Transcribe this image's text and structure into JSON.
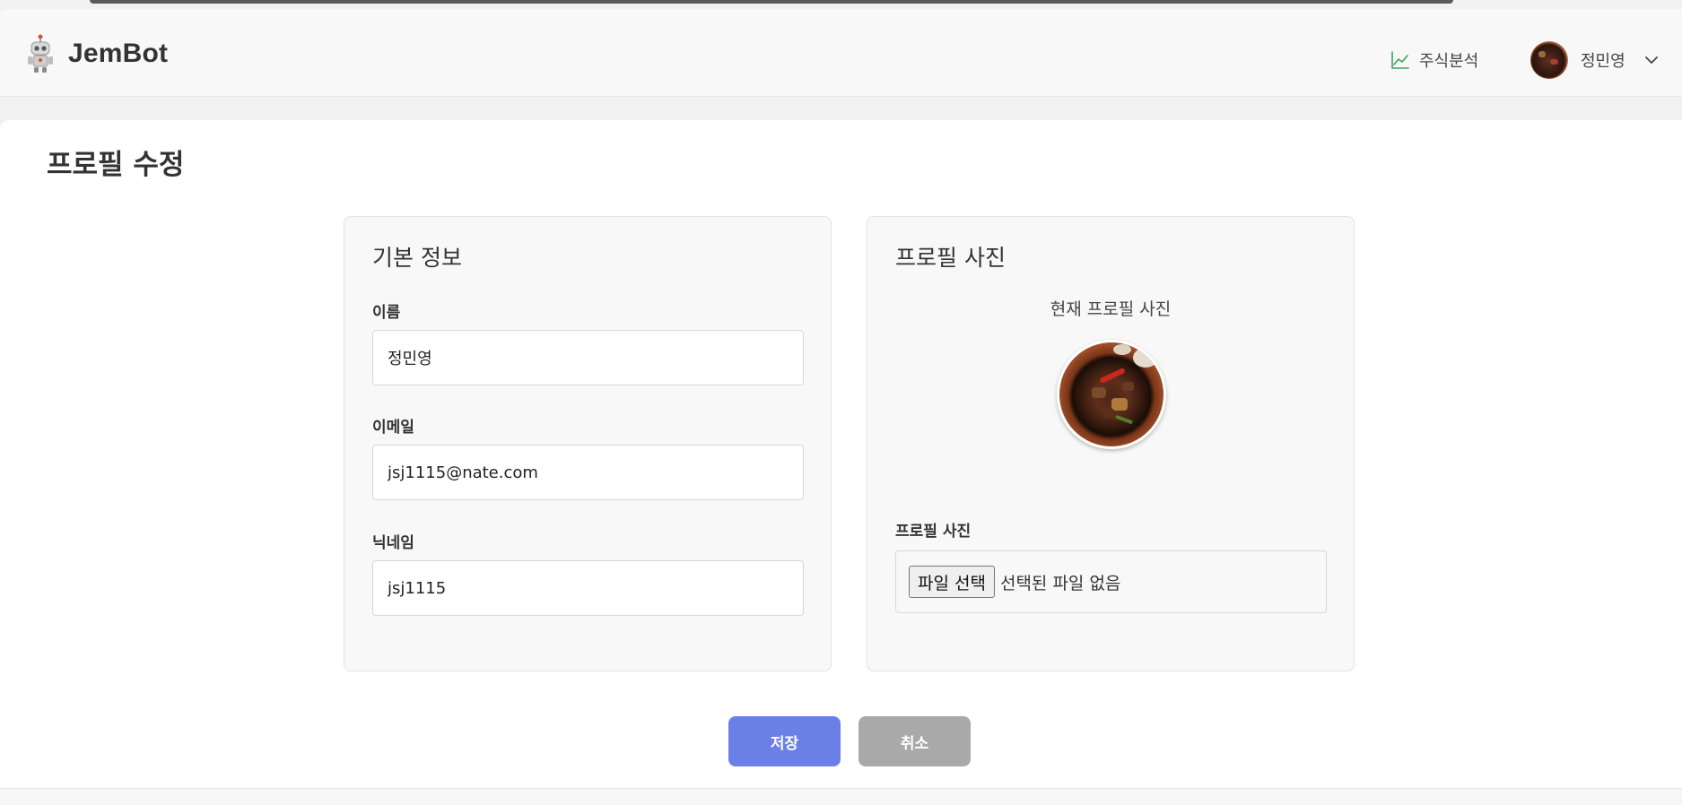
{
  "header": {
    "brand_name": "JemBot",
    "nav_stock_label": "주식분석",
    "user_name": "정민영"
  },
  "page": {
    "title": "프로필 수정"
  },
  "basic_info": {
    "heading": "기본 정보",
    "name_label": "이름",
    "name_value": "정민영",
    "email_label": "이메일",
    "email_value": "jsj1115@nate.com",
    "nickname_label": "닉네임",
    "nickname_value": "jsj1115"
  },
  "profile_photo": {
    "heading": "프로필 사진",
    "current_label": "현재 프로필 사진",
    "upload_label": "프로필 사진",
    "file_button_label": "파일 선택",
    "file_status": "선택된 파일 없음"
  },
  "actions": {
    "save_label": "저장",
    "cancel_label": "취소"
  },
  "colors": {
    "save_button": "#6b80e6",
    "cancel_button": "#a9a9a9",
    "stock_icon": "#3aa35a"
  },
  "icons": {
    "brand": "robot-icon",
    "stock": "line-chart-icon",
    "user_menu": "chevron-down-icon"
  }
}
